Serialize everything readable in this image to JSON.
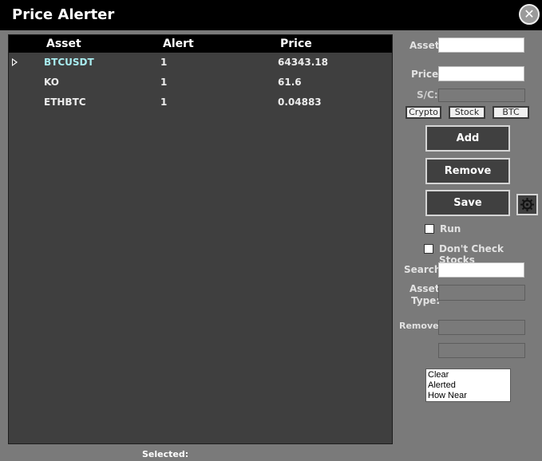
{
  "window": {
    "title": "Price Alerter"
  },
  "grid": {
    "columns": [
      "Asset",
      "Alert",
      "Price"
    ],
    "rows": [
      {
        "asset": "BTCUSDT",
        "alert": "1",
        "price": "64343.18",
        "selected": true
      },
      {
        "asset": "KO",
        "alert": "1",
        "price": "61.6",
        "selected": false
      },
      {
        "asset": "ETHBTC",
        "alert": "1",
        "price": "0.04883",
        "selected": false
      }
    ]
  },
  "status": {
    "selected_label": "Selected:"
  },
  "form": {
    "asset_label": "Asset:",
    "price_label": "Price:",
    "sc_label": "S/C:",
    "type_buttons": [
      "Crypto",
      "Stock",
      "BTC"
    ],
    "add_label": "Add",
    "remove_label": "Remove",
    "save_label": "Save",
    "run_label": "Run",
    "dont_check_label": "Don't Check Stocks",
    "search_label": "Search:",
    "asset_type_label_1": "Asset",
    "asset_type_label_2": "Type:",
    "removed_label": "Removed:"
  },
  "list_options": [
    "Clear",
    "Alerted",
    "How Near"
  ],
  "icons": {
    "close": "close-icon",
    "gear": "gear-icon",
    "row_pointer": "row-pointer-icon"
  },
  "colors": {
    "highlight_text": "#a8ecef",
    "grid_bg": "#3f3f3f",
    "titlebar": "#000000"
  }
}
